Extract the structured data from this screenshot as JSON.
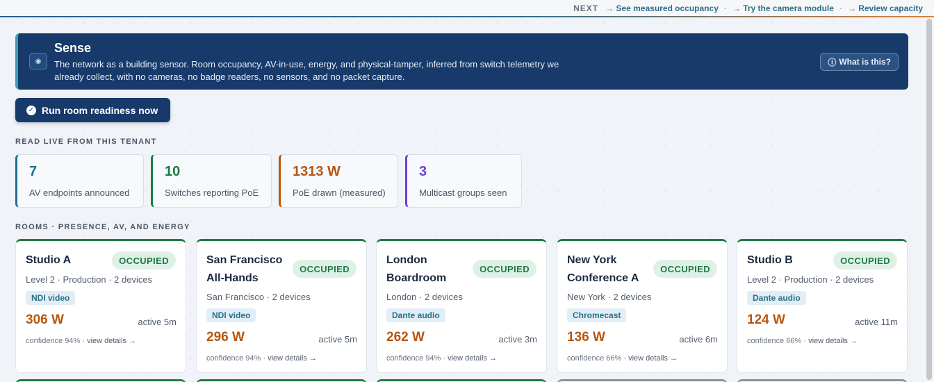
{
  "nextbar": {
    "next_label": "NEXT",
    "links": [
      "→ See measured occupancy",
      "→ Try the camera module",
      "→ Review capacity"
    ],
    "separator": "·"
  },
  "banner": {
    "icon": "eye-icon",
    "title": "Sense",
    "description": "The network as a building sensor. Room occupancy, AV-in-use, energy, and physical-tamper, inferred from switch telemetry we already collect, with no cameras, no badge readers, no sensors, and no packet capture.",
    "what_label": "What is this?"
  },
  "run_button": {
    "label": "Run room readiness now"
  },
  "stats_section": {
    "label": "READ LIVE FROM THIS TENANT",
    "items": [
      {
        "value": "7",
        "label": "AV endpoints announced",
        "color": "#1e6f8a"
      },
      {
        "value": "10",
        "label": "Switches reporting PoE",
        "color": "#1f7a45"
      },
      {
        "value": "1313 W",
        "label": "PoE drawn (measured)",
        "color": "#b8560f"
      },
      {
        "value": "3",
        "label": "Multicast groups seen",
        "color": "#6a3fd6"
      }
    ]
  },
  "rooms_section": {
    "label": "ROOMS · PRESENCE, AV, AND ENERGY",
    "rooms": [
      {
        "name": "Studio A",
        "status": "OCCUPIED",
        "meta": "Level 2 · Production · 2 devices",
        "tag": "NDI video",
        "watts": "306 W",
        "active": "active 5m",
        "confidence": "confidence 94%",
        "details": "· view details →"
      },
      {
        "name": "San Francisco All-Hands",
        "status": "OCCUPIED",
        "meta": "San Francisco · 2 devices",
        "tag": "NDI video",
        "watts": "296 W",
        "active": "active 5m",
        "confidence": "confidence 94%",
        "details": "· view details →"
      },
      {
        "name": "London Boardroom",
        "status": "OCCUPIED",
        "meta": "London · 2 devices",
        "tag": "Dante audio",
        "watts": "262 W",
        "active": "active 3m",
        "confidence": "confidence 94%",
        "details": "· view details →"
      },
      {
        "name": "New York Conference A",
        "status": "OCCUPIED",
        "meta": "New York · 2 devices",
        "tag": "Chromecast",
        "watts": "136 W",
        "active": "active 6m",
        "confidence": "confidence 66%",
        "details": "· view details →"
      },
      {
        "name": "Studio B",
        "status": "OCCUPIED",
        "meta": "Level 2 · Production · 2 devices",
        "tag": "Dante audio",
        "watts": "124 W",
        "active": "active 11m",
        "confidence": "confidence 66%",
        "details": "· view details →"
      }
    ]
  }
}
